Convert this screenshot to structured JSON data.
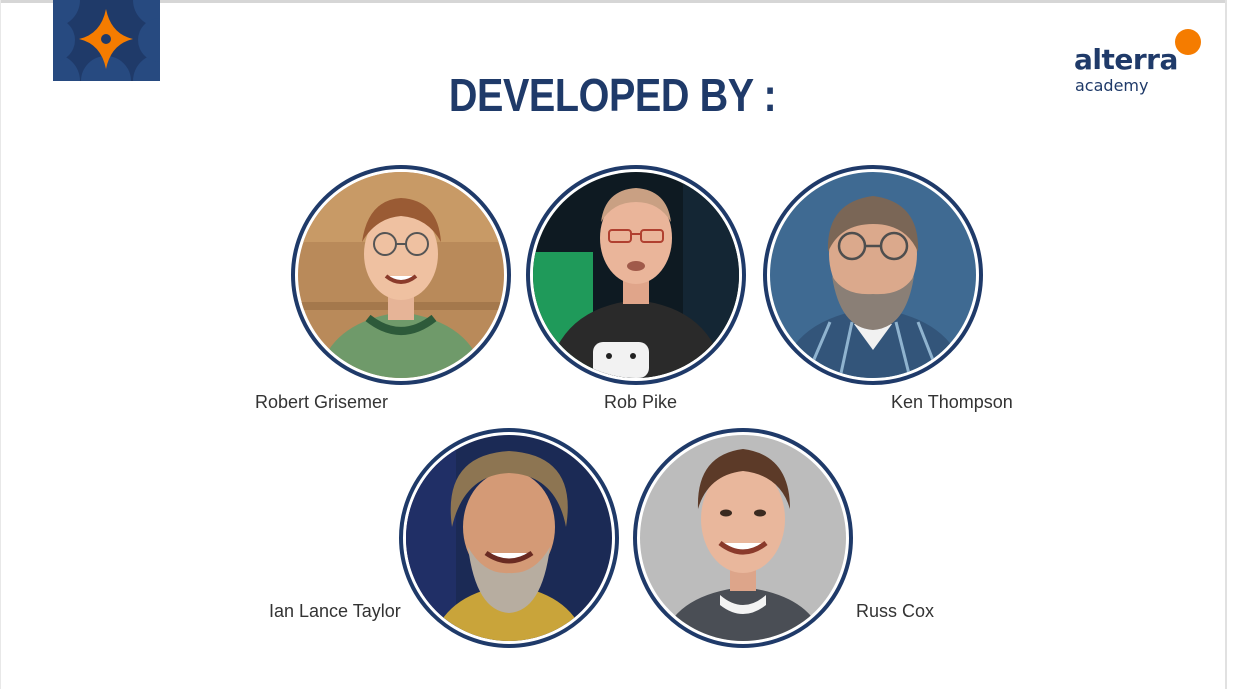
{
  "title": "DEVELOPED BY :",
  "brand": {
    "word": "alterra",
    "sub": "academy",
    "accent_color": "#f57c00",
    "navy_color": "#1f3a69"
  },
  "icons": {
    "brand_tile": "orange-star-pattern-tile",
    "academy_logo": "alterra-academy-logo"
  },
  "developers": [
    {
      "name": "Robert Grisemer"
    },
    {
      "name": "Rob Pike"
    },
    {
      "name": "Ken Thompson"
    },
    {
      "name": "Ian Lance Taylor"
    },
    {
      "name": "Russ Cox"
    }
  ]
}
